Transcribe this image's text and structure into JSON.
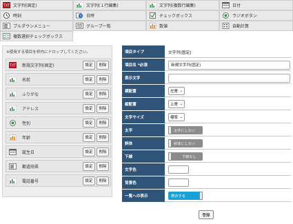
{
  "palette": {
    "items": [
      {
        "label": "文字列(固定)",
        "icon": "fixed-text-icon"
      },
      {
        "label": "文字列(１行編集)",
        "icon": "single-line-text-icon"
      },
      {
        "label": "文字列(複数行編集)",
        "icon": "multi-line-text-icon"
      },
      {
        "label": "日付",
        "icon": "calendar-icon"
      },
      {
        "label": "時刻",
        "icon": "clock-icon"
      },
      {
        "label": "日時",
        "icon": "datetime-icon"
      },
      {
        "label": "チェックボックス",
        "icon": "checkbox-icon"
      },
      {
        "label": "ラジオボタン",
        "icon": "radio-icon"
      },
      {
        "label": "プルダウンメニュー",
        "icon": "dropdown-icon"
      },
      {
        "label": "グループ一覧",
        "icon": "group-list-icon"
      },
      {
        "label": "数値",
        "icon": "number-icon"
      },
      {
        "label": "自動計算",
        "icon": "auto-calc-icon"
      },
      {
        "label": "複数選択チェックボックス",
        "icon": "multi-checkbox-icon"
      }
    ]
  },
  "left_panel": {
    "hint": "※使用する項目を枠内にドロップしてください。",
    "settings_label": "設定",
    "delete_label": "削除",
    "fields": [
      {
        "label": "新規文字列(固定)",
        "icon": "fixed-text-icon"
      },
      {
        "label": "名前",
        "icon": "single-line-text-icon"
      },
      {
        "label": "ふりがな",
        "icon": "single-line-text-icon"
      },
      {
        "label": "アドレス",
        "icon": "single-line-text-icon"
      },
      {
        "label": "性別",
        "icon": "radio-icon"
      },
      {
        "label": "年齢",
        "icon": "number-icon"
      },
      {
        "label": "誕生日",
        "icon": "calendar-icon"
      },
      {
        "label": "都道府県",
        "icon": "dropdown-icon"
      },
      {
        "label": "電話番号",
        "icon": "single-line-text-icon"
      }
    ]
  },
  "properties": {
    "item_type": {
      "label": "項目タイプ",
      "value": "文字列(固定)"
    },
    "item_name": {
      "label": "項目名 *必須",
      "value": "新規文字列(固定)"
    },
    "display_text": {
      "label": "表示文字",
      "value": ""
    },
    "h_align": {
      "label": "横配置",
      "value": "左寄"
    },
    "v_align": {
      "label": "縦配置",
      "value": "上寄"
    },
    "font_size": {
      "label": "文字サイズ",
      "value": "標準"
    },
    "bold": {
      "label": "太字",
      "value": "太字にしない"
    },
    "italic": {
      "label": "斜体",
      "value": "斜体にしない"
    },
    "underline": {
      "label": "下線",
      "value": "下線なし"
    },
    "text_color": {
      "label": "文字色"
    },
    "bg_color": {
      "label": "背景色"
    },
    "list_display": {
      "label": "一覧への表示",
      "value": "表示する"
    }
  },
  "register_label": "登録",
  "colors": {
    "label_bg": "#2f5478",
    "toggle_on": "#1aa1d6",
    "toggle_off": "#8c8c8c"
  }
}
